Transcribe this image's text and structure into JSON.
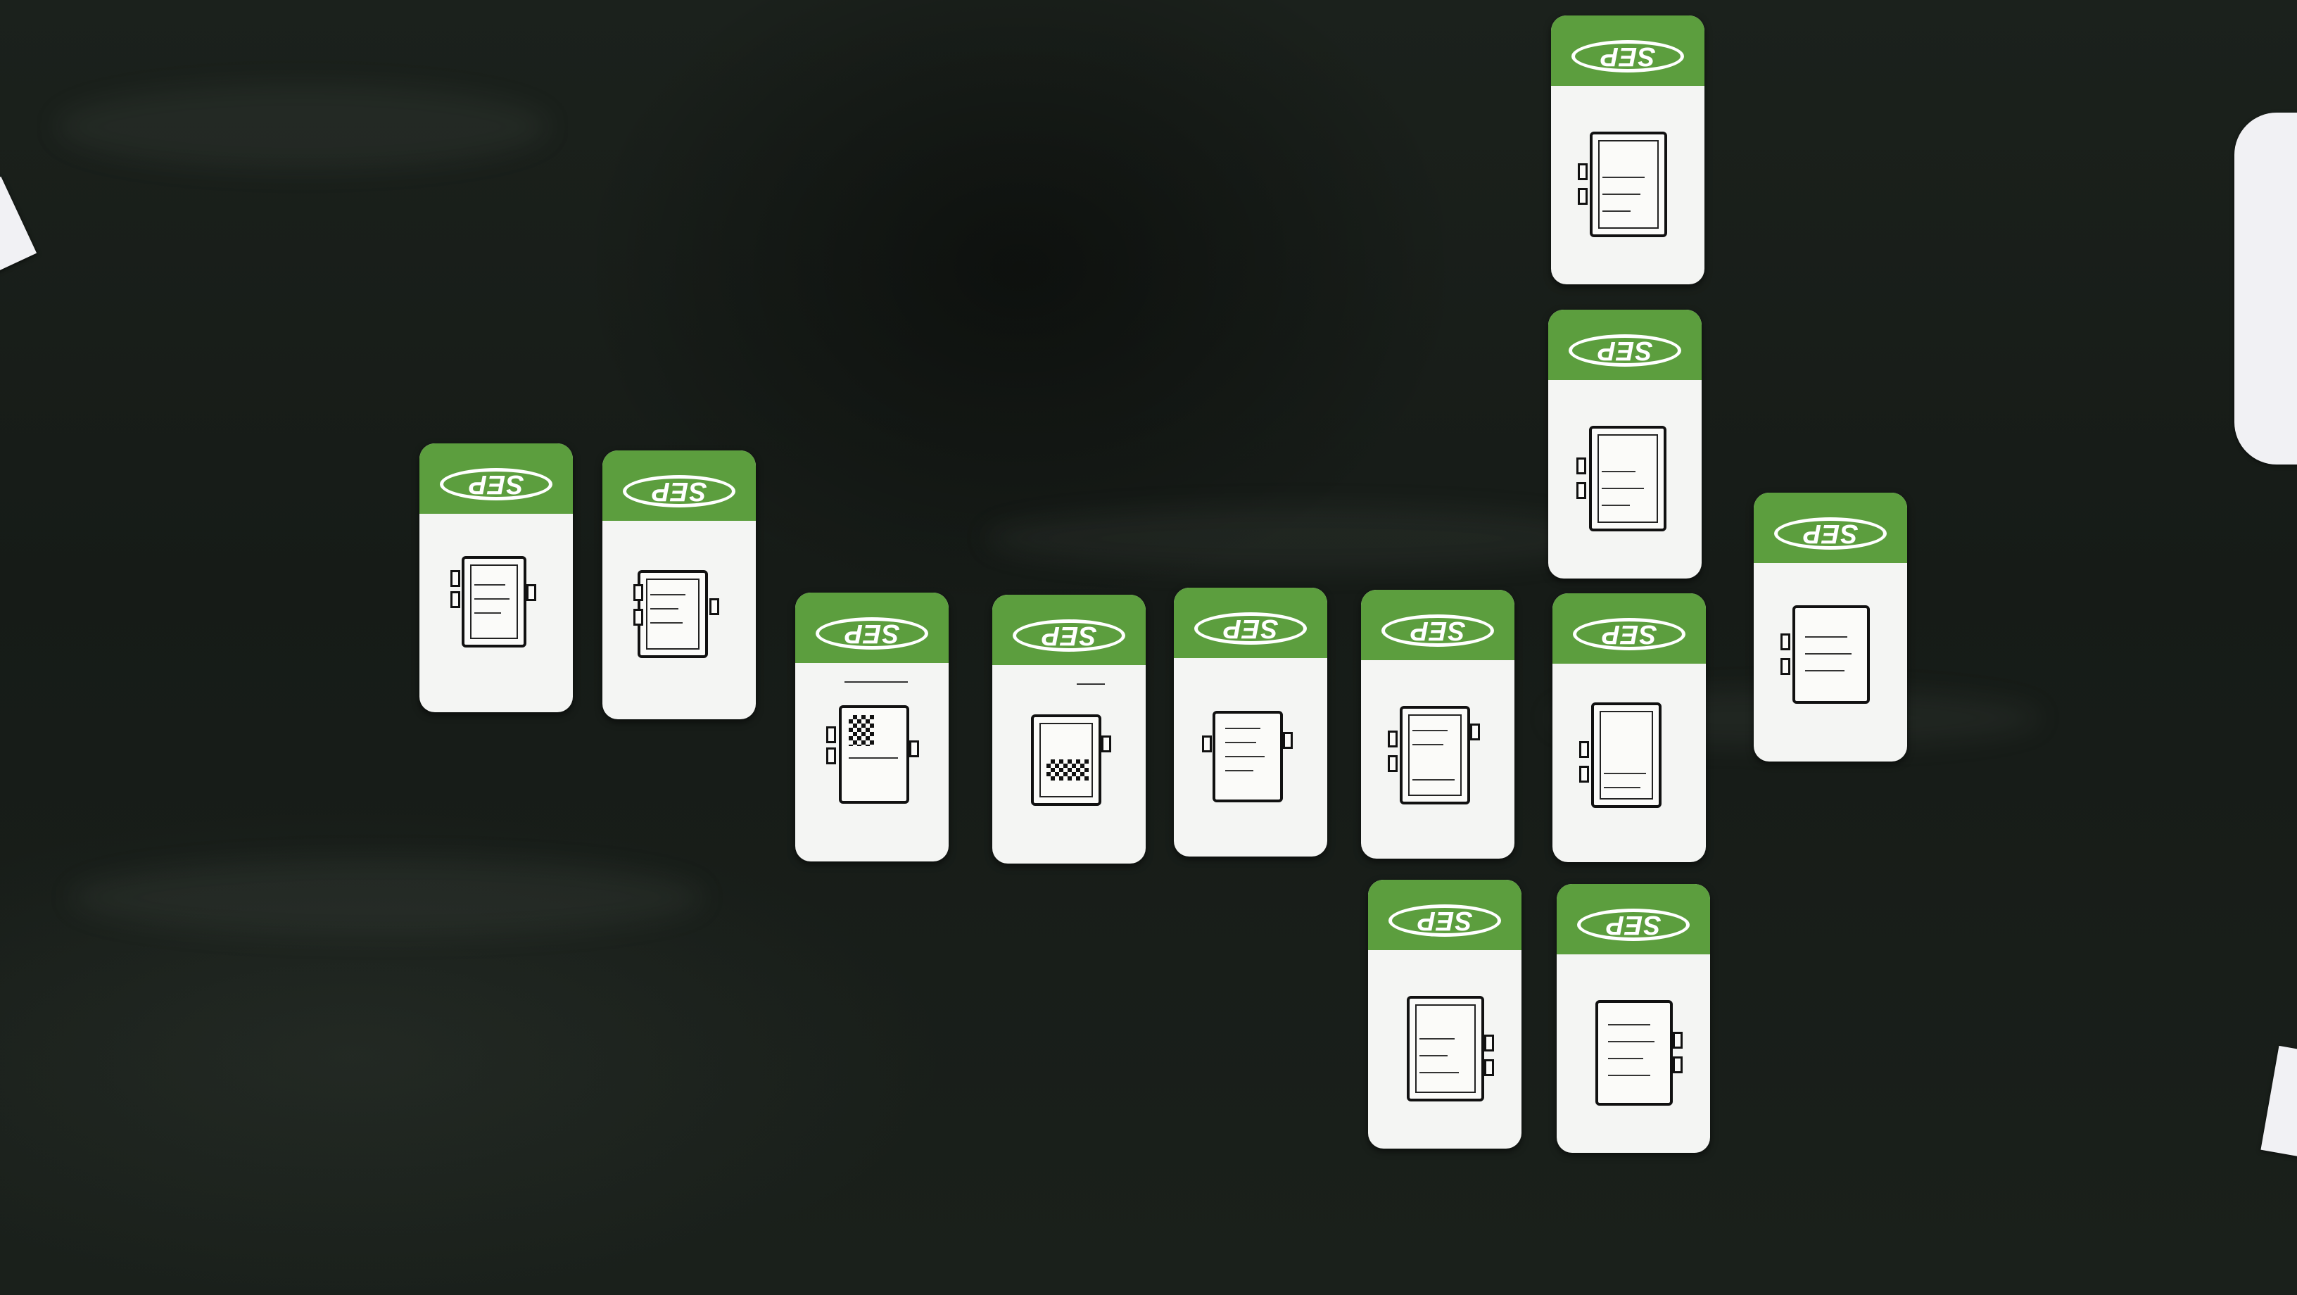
{
  "scene": {
    "description_colors": {
      "background": "#1a201b",
      "card": "#f4f5f3",
      "card_band": "#5c9e3e",
      "sketch_ink": "#111111"
    },
    "card_logo_text": "SEP",
    "card_count": 14
  }
}
